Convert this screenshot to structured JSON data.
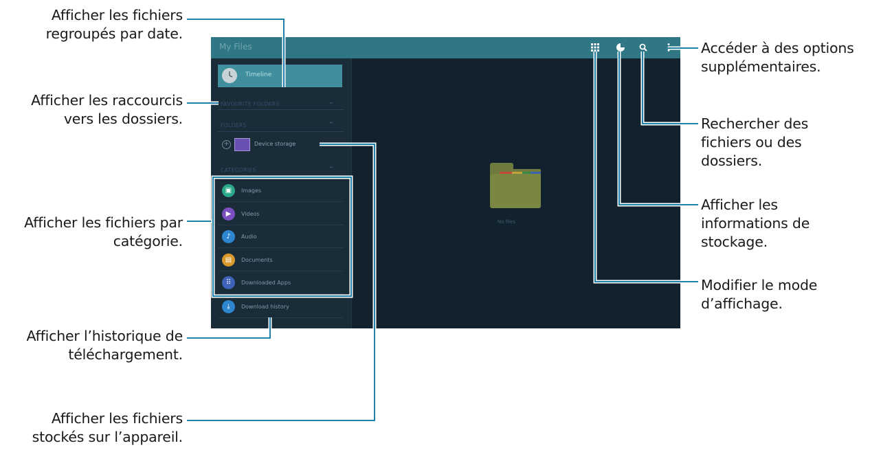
{
  "screen": {
    "app_title": "My Files",
    "drawer": {
      "timeline_label": "Timeline",
      "favourite_folders_header": "FAVOURITE FOLDERS",
      "folders_header": "FOLDERS",
      "storage_label": "Device storage",
      "categories_header": "CATEGORIES",
      "categories": [
        {
          "label": "Images",
          "icon": "image-icon",
          "color": "#2aa98a",
          "glyph": "▣"
        },
        {
          "label": "Videos",
          "icon": "video-icon",
          "color": "#7a4fc0",
          "glyph": "▶"
        },
        {
          "label": "Audio",
          "icon": "music-note-icon",
          "color": "#2f86d0",
          "glyph": "♪"
        },
        {
          "label": "Documents",
          "icon": "document-icon",
          "color": "#d99a2b",
          "glyph": "▤"
        },
        {
          "label": "Downloaded Apps",
          "icon": "apps-icon",
          "color": "#3f63b8",
          "glyph": "⠿"
        }
      ],
      "download_history_label": "Download history",
      "download_history_color": "#2f86d0"
    },
    "empty_label": "No files",
    "action_icons": [
      "grid-view-icon",
      "storage-pie-icon",
      "search-icon",
      "more-options-icon"
    ]
  },
  "callouts": {
    "timeline": {
      "line1": "Afficher les fichiers",
      "line2": "regroupés par date."
    },
    "shortcuts": {
      "line1": "Afficher les raccourcis",
      "line2": "vers les dossiers."
    },
    "categories": {
      "line1": "Afficher les fichiers par",
      "line2": "catégorie."
    },
    "history": {
      "line1": "Afficher l’historique de",
      "line2": "téléchargement."
    },
    "device": {
      "line1": "Afficher les fichiers",
      "line2": "stockés sur l’appareil."
    },
    "options": {
      "line1": "Accéder à des options",
      "line2": "supplémentaires."
    },
    "search": {
      "line1": "Rechercher des",
      "line2": "fichiers ou des",
      "line3": "dossiers."
    },
    "storage": {
      "line1": "Afficher les",
      "line2": "informations de",
      "line3": "stockage."
    },
    "view_mode": {
      "line1": "Modifier le mode",
      "line2": "d’affichage."
    }
  },
  "colors": {
    "leader_line": "#1e7fa8",
    "action_bar": "#2f7784",
    "screen_background": "#12212e"
  }
}
